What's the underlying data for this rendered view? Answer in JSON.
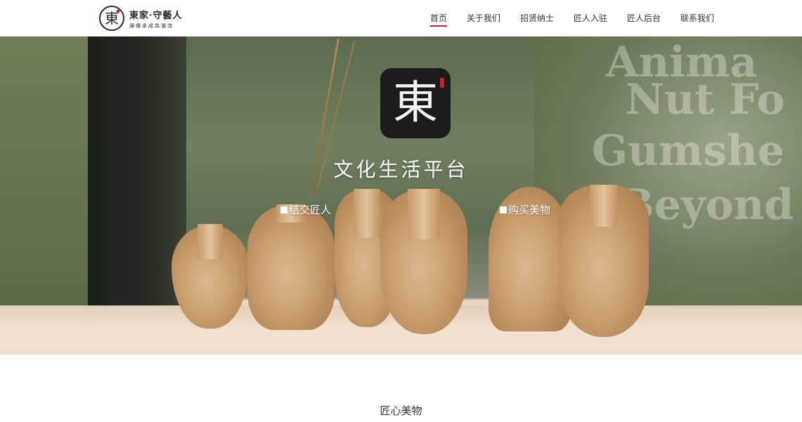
{
  "brand": {
    "logo_char": "東",
    "name": "東家·守藝人",
    "slogan": "讓傳承成為潮流"
  },
  "nav": {
    "items": [
      {
        "label": "首页",
        "active": true
      },
      {
        "label": "关于我们",
        "active": false
      },
      {
        "label": "招贤纳士",
        "active": false
      },
      {
        "label": "匠人入驻",
        "active": false
      },
      {
        "label": "匠人后台",
        "active": false
      },
      {
        "label": "联系我们",
        "active": false
      }
    ]
  },
  "hero": {
    "app_icon_char": "東",
    "title": "文化生活平台",
    "links": [
      {
        "label": "结交匠人"
      },
      {
        "label": "购买美物"
      }
    ]
  },
  "section": {
    "title": "匠心美物"
  },
  "colors": {
    "accent": "#c8202a",
    "text": "#333333",
    "icon_bg": "#1b1b1b"
  }
}
